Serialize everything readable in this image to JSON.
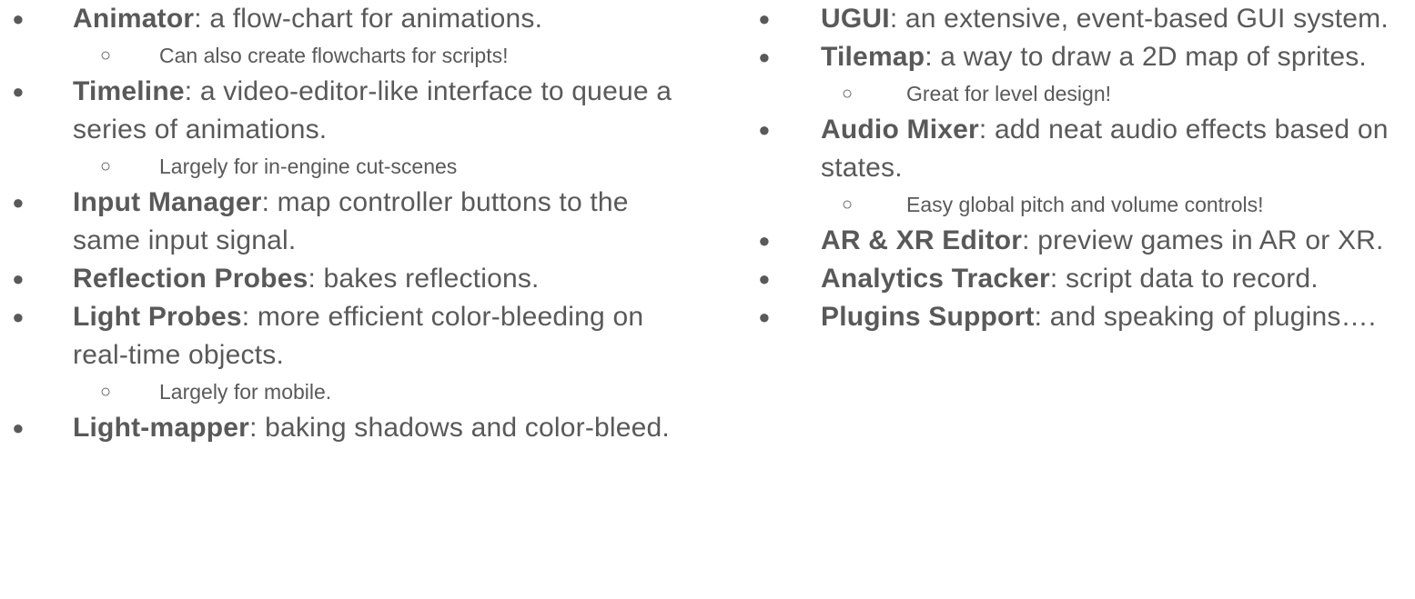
{
  "columns": [
    {
      "items": [
        {
          "term": "Animator",
          "desc": ": a flow-chart for animations.",
          "subs": [
            "Can also create flowcharts for scripts!"
          ]
        },
        {
          "term": "Timeline",
          "desc": ": a video-editor-like interface to queue a series of animations.",
          "subs": [
            "Largely for in-engine cut-scenes"
          ]
        },
        {
          "term": "Input Manager",
          "desc": ": map controller buttons to the same input signal.",
          "subs": []
        },
        {
          "term": "Reflection Probes",
          "desc": ": bakes reflections.",
          "subs": []
        },
        {
          "term": "Light Probes",
          "desc": ": more efficient color-bleeding on real-time objects.",
          "subs": [
            "Largely for mobile."
          ]
        },
        {
          "term": "Light-mapper",
          "desc": ": baking shadows and color-bleed.",
          "subs": []
        }
      ]
    },
    {
      "items": [
        {
          "term": "UGUI",
          "desc": ": an extensive, event-based GUI system.",
          "subs": []
        },
        {
          "term": "Tilemap",
          "desc": ": a way to draw a 2D map of sprites.",
          "subs": [
            "Great for level design!"
          ]
        },
        {
          "term": "Audio Mixer",
          "desc": ": add neat audio effects based on states.",
          "subs": [
            "Easy global pitch and volume controls!"
          ]
        },
        {
          "term": "AR & XR Editor",
          "desc": ": preview games in AR or XR.",
          "subs": []
        },
        {
          "term": "Analytics Tracker",
          "desc": ": script data to record.",
          "subs": []
        },
        {
          "term": "Plugins Support",
          "desc": ": and speaking of plugins….",
          "subs": []
        }
      ]
    }
  ],
  "bullet_glyphs": {
    "main": "●",
    "sub": "○"
  },
  "colors": {
    "text": "#595959",
    "background": "#ffffff"
  }
}
